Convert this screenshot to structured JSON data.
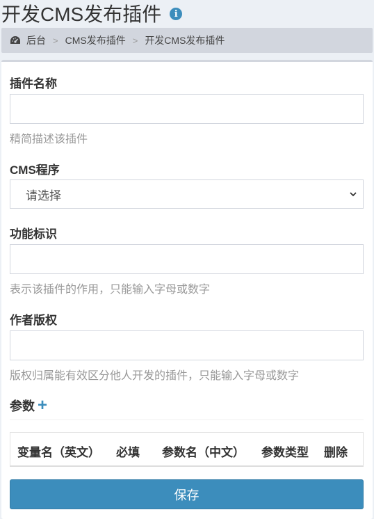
{
  "header": {
    "title": "开发CMS发布插件",
    "info_icon": "info-circle-icon"
  },
  "breadcrumb": {
    "icon": "dashboard-icon",
    "items": [
      "后台",
      "CMS发布插件",
      "开发CMS发布插件"
    ],
    "separator": ">"
  },
  "form": {
    "plugin_name": {
      "label": "插件名称",
      "value": "",
      "help": "精简描述该插件"
    },
    "cms": {
      "label": "CMS程序",
      "selected": "请选择"
    },
    "function_id": {
      "label": "功能标识",
      "value": "",
      "help": "表示该插件的作用，只能输入字母或数字"
    },
    "copyright": {
      "label": "作者版权",
      "value": "",
      "help": "版权归属能有效区分他人开发的插件，只能输入字母或数字"
    },
    "params": {
      "title": "参数",
      "add_icon": "plus-icon",
      "columns": [
        "变量名（英文）",
        "必填",
        "参数名（中文）",
        "参数类型",
        "删除"
      ]
    },
    "save_label": "保存"
  },
  "colors": {
    "primary": "#3c8dbc",
    "background": "#ecf0f5",
    "breadcrumb_bg": "#d2d6de",
    "help_text": "#999999"
  }
}
